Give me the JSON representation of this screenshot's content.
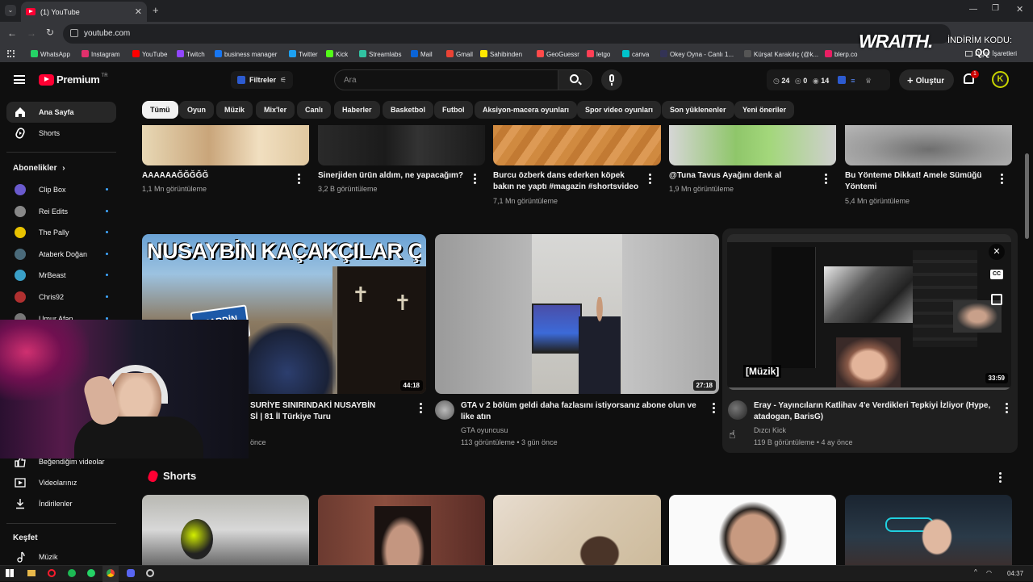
{
  "browser": {
    "tab_title": "(1) YouTube",
    "url": "youtube.com",
    "bookmarks": [
      {
        "label": "WhatsApp",
        "color": "#25d366"
      },
      {
        "label": "Instagram",
        "color": "#e1306c"
      },
      {
        "label": "YouTube",
        "color": "#ff0000"
      },
      {
        "label": "Twitch",
        "color": "#9146ff"
      },
      {
        "label": "business manager",
        "color": "#1877f2"
      },
      {
        "label": "Twitter",
        "color": "#1da1f2"
      },
      {
        "label": "Kick",
        "color": "#53fc18"
      },
      {
        "label": "Streamlabs",
        "color": "#31c3a2"
      },
      {
        "label": "Mail",
        "color": "#0a64d8"
      },
      {
        "label": "Gmail",
        "color": "#ea4335"
      },
      {
        "label": "Sahibinden",
        "color": "#ffe800"
      },
      {
        "label": "GeoGuessr",
        "color": "#ff4a4a"
      },
      {
        "label": "letgo",
        "color": "#ff3f55"
      },
      {
        "label": "canva",
        "color": "#00c4cc"
      },
      {
        "label": "Okey Oyna - Canlı 1...",
        "color": "#335"
      },
      {
        "label": "Kürşat Karakılıç (@k...",
        "color": "#555"
      },
      {
        "label": "blerp.co",
        "color": "#e91e63"
      }
    ],
    "bookmarks_right": "Diğer İşaretleri"
  },
  "overlay": {
    "brand": "WRAITH.",
    "promo_label": "İNDİRİM KODU:",
    "promo_code": "QQ"
  },
  "header": {
    "logo_text": "Premium",
    "logo_badge": "TR",
    "filters_label": "Filtreler",
    "search_placeholder": "Ara",
    "stats": {
      "a": "24",
      "b": "0",
      "c": "14"
    },
    "create_label": "Oluştur",
    "notif_count": "1",
    "avatar_letter": "K"
  },
  "chips": [
    "Tümü",
    "Oyun",
    "Müzik",
    "Mix'ler",
    "Canlı",
    "Haberler",
    "Basketbol",
    "Futbol",
    "Aksiyon-macera oyunları",
    "Spor video oyunları",
    "Son yüklenenler",
    "Yeni öneriler"
  ],
  "sidebar": {
    "home": "Ana Sayfa",
    "shorts": "Shorts",
    "subs_title": "Abonelikler",
    "subs": [
      {
        "name": "Clip Box",
        "color": "#6a5acd"
      },
      {
        "name": "Rei Edits",
        "color": "#888"
      },
      {
        "name": "The Pally",
        "color": "#e8c200"
      },
      {
        "name": "Ataberk Doğan",
        "color": "#4a6a7a"
      },
      {
        "name": "MrBeast",
        "color": "#3aa0c8"
      },
      {
        "name": "Chris92",
        "color": "#b03030"
      },
      {
        "name": "Umur Afan",
        "color": "#777"
      }
    ],
    "liked": "Beğendiğim videolar",
    "your_videos": "Videolarınız",
    "downloads": "İndirilenler",
    "explore_title": "Keşfet",
    "music": "Müzik"
  },
  "row1": [
    {
      "title": "AAAAAAĞĞĞĞĞ",
      "title2": "",
      "meta": "1,1 Mn görüntüleme"
    },
    {
      "title": "Sinerjiden ürün aldım, ne yapacağım?",
      "title2": "",
      "meta": "3,2 B görüntüleme"
    },
    {
      "title": "Burcu özberk dans ederken köpek",
      "title2": "bakın ne yaptı #magazin #shortsvideo",
      "meta": "7,1 Mn görüntüleme"
    },
    {
      "title": "@Tuna Tavus Ayağını denk al",
      "title2": "",
      "meta": "1,9 Mn görüntüleme"
    },
    {
      "title": "Bu Yönteme Dikkat! Amele Sümüğü",
      "title2": "Yöntemi",
      "meta": "5,4 Mn görüntüleme"
    }
  ],
  "row2": [
    {
      "thumb_text": "NUSAYBİN KAÇAKÇILAR ÇARŞISI",
      "sign_text": "MARDİN",
      "duration": "44:18",
      "title": "SURİYE SINIRINDAKİ NUSAYBİN",
      "title2": "Sİ | 81 İl Türkiye Turu",
      "meta": "önce"
    },
    {
      "duration": "27:18",
      "title": "GTA v 2 bölüm geldi daha fazlasını istiyorsanız abone olun ve",
      "title2": "like atın",
      "channel": "GTA oyuncusu",
      "meta": "113 görüntüleme • 3 gün önce"
    },
    {
      "duration": "33:59",
      "caption": "[Müzik]",
      "cc": "CC",
      "title": "Eray - Yayıncıların Katlihav 4'e Verdikleri Tepkiyi İzliyor (Hype,",
      "title2": "atadogan, BarisG)",
      "channel": "Dızcı Kick",
      "meta": "119 B görüntüleme • 4 ay önce"
    }
  ],
  "shorts_title": "Shorts",
  "taskbar": {
    "time": "04:37"
  }
}
